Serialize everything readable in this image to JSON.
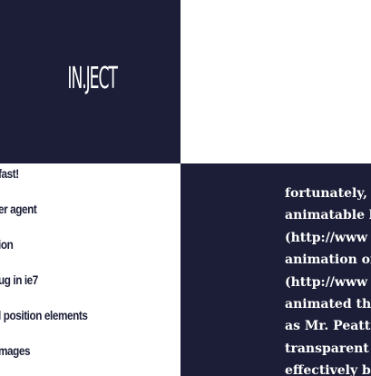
{
  "brand": {
    "logo_text": "IN.JECT"
  },
  "colors": {
    "navy": "#1b1e36",
    "white": "#ffffff"
  },
  "nav": {
    "items": [
      "fast!",
      "er agent",
      "ion",
      "ug in ie7",
      "l position elements",
      "mages"
    ]
  },
  "article": {
    "lines": [
      "fortunately, s",
      "animatable b",
      "(http://www",
      "animation of",
      "(http://www",
      "animated the",
      "as Mr. Peatti",
      "transparent a",
      "effectively be"
    ]
  }
}
